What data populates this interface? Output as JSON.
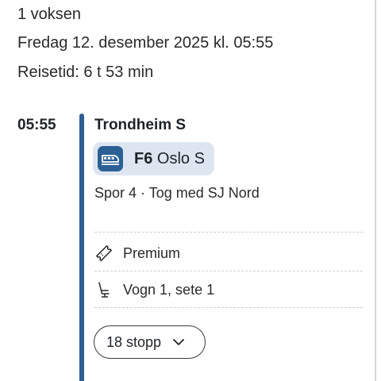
{
  "trip": {
    "passengers": "1 voksen",
    "departure_datetime": "Fredag 12. desember 2025 kl. 05:55",
    "travel_time": "Reisetid: 6 t 53 min"
  },
  "leg": {
    "departure_time": "05:55",
    "station": "Trondheim S",
    "train": {
      "line": "F6",
      "destination": "Oslo S",
      "icon": "train-icon"
    },
    "platform_info": "Spor 4 · Tog med SJ Nord",
    "ticket_class": "Premium",
    "seat": "Vogn 1, sete 1",
    "stops_button_label": "18 stopp"
  },
  "colors": {
    "accent": "#2c5f94",
    "chip_background": "#dde6f0"
  },
  "icons": {
    "ticket": "ticket-icon",
    "seat": "seat-icon",
    "expand": "chevron-down-icon"
  }
}
